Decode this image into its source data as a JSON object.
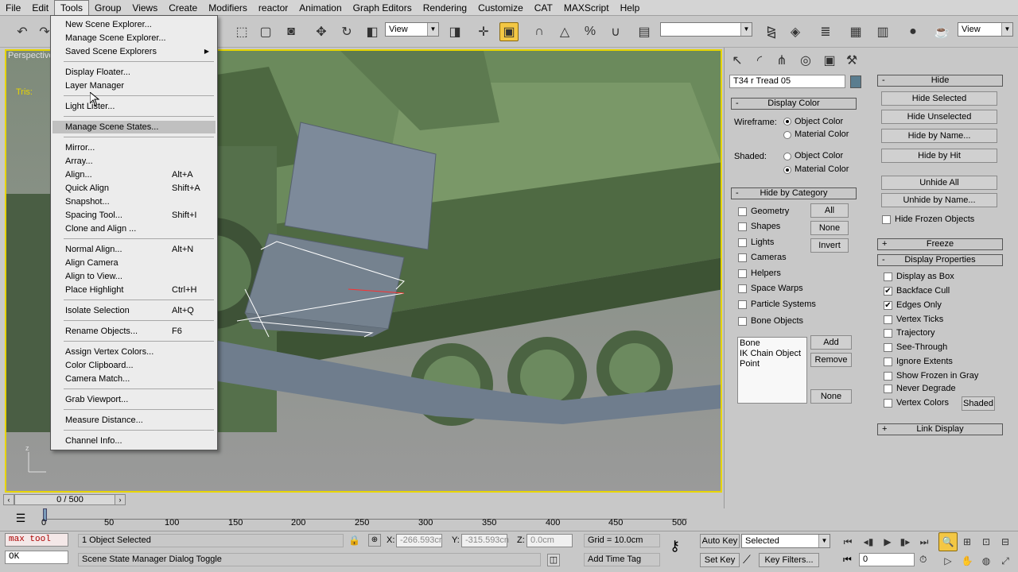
{
  "menubar": [
    "File",
    "Edit",
    "Tools",
    "Group",
    "Views",
    "Create",
    "Modifiers",
    "reactor",
    "Animation",
    "Graph Editors",
    "Rendering",
    "Customize",
    "CAT",
    "MAXScript",
    "Help"
  ],
  "toolbar": {
    "view_select_1": "View",
    "view_select_2": "View"
  },
  "viewport": {
    "label": "Perspective",
    "overlay_text": "Tris:"
  },
  "tools_menu": [
    {
      "label": "New Scene Explorer...",
      "shortcut": ""
    },
    {
      "label": "Manage Scene Explorer...",
      "shortcut": ""
    },
    {
      "label": "Saved Scene Explorers",
      "shortcut": ""
    },
    {
      "label": "Display Floater...",
      "shortcut": ""
    },
    {
      "label": "Layer Manager",
      "shortcut": ""
    },
    {
      "label": "Light Lister...",
      "shortcut": ""
    },
    {
      "label": "Manage Scene States...",
      "shortcut": ""
    },
    {
      "label": "Mirror...",
      "shortcut": ""
    },
    {
      "label": "Array...",
      "shortcut": ""
    },
    {
      "label": "Align...",
      "shortcut": "Alt+A"
    },
    {
      "label": "Quick Align",
      "shortcut": "Shift+A"
    },
    {
      "label": "Snapshot...",
      "shortcut": ""
    },
    {
      "label": "Spacing Tool...",
      "shortcut": "Shift+I"
    },
    {
      "label": "Clone and Align ...",
      "shortcut": ""
    },
    {
      "label": "Normal Align...",
      "shortcut": "Alt+N"
    },
    {
      "label": "Align Camera",
      "shortcut": ""
    },
    {
      "label": "Align to View...",
      "shortcut": ""
    },
    {
      "label": "Place Highlight",
      "shortcut": "Ctrl+H"
    },
    {
      "label": "Isolate Selection",
      "shortcut": "Alt+Q"
    },
    {
      "label": "Rename Objects...",
      "shortcut": "F6"
    },
    {
      "label": "Assign Vertex Colors...",
      "shortcut": ""
    },
    {
      "label": "Color Clipboard...",
      "shortcut": ""
    },
    {
      "label": "Camera Match...",
      "shortcut": ""
    },
    {
      "label": "Grab Viewport...",
      "shortcut": ""
    },
    {
      "label": "Measure Distance...",
      "shortcut": ""
    },
    {
      "label": "Channel Info...",
      "shortcut": ""
    }
  ],
  "object_name": "T34 r Tread 05",
  "display_color": {
    "title": "Display Color",
    "wireframe_label": "Wireframe:",
    "shaded_label": "Shaded:",
    "object_color": "Object Color",
    "material_color": "Material Color"
  },
  "hide_by_category": {
    "title": "Hide by Category",
    "items": [
      "Geometry",
      "Shapes",
      "Lights",
      "Cameras",
      "Helpers",
      "Space Warps",
      "Particle Systems",
      "Bone Objects"
    ],
    "buttons": [
      "All",
      "None",
      "Invert"
    ],
    "list": [
      "Bone",
      "IK Chain Object",
      "Point"
    ],
    "list_buttons": [
      "Add",
      "Remove",
      "None"
    ]
  },
  "hide": {
    "title": "Hide",
    "buttons": [
      "Hide Selected",
      "Hide Unselected",
      "Hide by Name...",
      "Hide by Hit",
      "Unhide All",
      "Unhide by Name..."
    ],
    "hide_frozen": "Hide Frozen Objects"
  },
  "freeze": {
    "title": "Freeze"
  },
  "display_properties": {
    "title": "Display Properties",
    "items": [
      {
        "label": "Display as Box",
        "checked": false
      },
      {
        "label": "Backface Cull",
        "checked": true
      },
      {
        "label": "Edges Only",
        "checked": true
      },
      {
        "label": "Vertex Ticks",
        "checked": false
      },
      {
        "label": "Trajectory",
        "checked": false
      },
      {
        "label": "See-Through",
        "checked": false
      },
      {
        "label": "Ignore Extents",
        "checked": false
      },
      {
        "label": "Show Frozen in Gray",
        "checked": false
      },
      {
        "label": "Never Degrade",
        "checked": false
      },
      {
        "label": "Vertex Colors",
        "checked": false
      }
    ],
    "shaded_button": "Shaded"
  },
  "link_display": {
    "title": "Link Display"
  },
  "timeline": {
    "frame": "0 / 500",
    "ticks": [
      "0",
      "50",
      "100",
      "150",
      "200",
      "250",
      "300",
      "350",
      "400",
      "450",
      "500"
    ]
  },
  "status": {
    "maxscript": "max tool",
    "ok": "OK",
    "selected": "1 Object Selected",
    "prompt": "Scene State Manager Dialog Toggle",
    "x_label": "X:",
    "x_value": "-266.593cr",
    "y_label": "Y:",
    "y_value": "-315.593cn",
    "z_label": "Z:",
    "z_value": "0.0cm",
    "grid": "Grid = 10.0cm",
    "add_time_tag": "Add Time Tag",
    "auto_key": "Auto Key",
    "set_key": "Set Key",
    "selected_dropdown": "Selected",
    "key_filters": "Key Filters...",
    "frame_field": "0"
  },
  "colors": {
    "viewport_border": "#e7d500",
    "active_tool": "#f3c744",
    "tank_green": "#5f7a4f",
    "tread_blue": "#7d8a9a"
  }
}
